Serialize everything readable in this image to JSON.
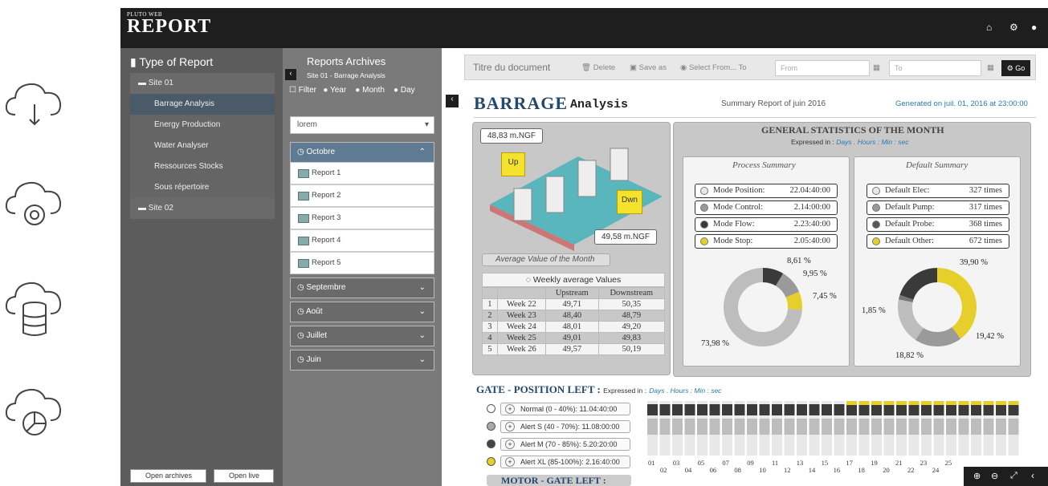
{
  "header": {
    "logo_small": "PLUTO WEB",
    "logo_big": "REPORT"
  },
  "left_icons": [
    "cloud-sync-icon",
    "cloud-gear-icon",
    "cloud-database-icon",
    "cloud-chart-icon"
  ],
  "nav": {
    "title": "Type of Report",
    "items": [
      {
        "label": "Site 01",
        "kind": "site"
      },
      {
        "label": "Barrage Analysis",
        "kind": "sub",
        "active": true
      },
      {
        "label": "Energy Production",
        "kind": "sub"
      },
      {
        "label": "Water Analyser",
        "kind": "sub"
      },
      {
        "label": "Ressources Stocks",
        "kind": "sub"
      },
      {
        "label": "Sous répertoire",
        "kind": "sub"
      },
      {
        "label": "Site 02",
        "kind": "site"
      }
    ],
    "open_archives": "Open archives",
    "open_live": "Open live"
  },
  "archive": {
    "title": "Reports Archives",
    "subtitle": "Site 01 - Barrage Analysis",
    "filter": "Filter",
    "year": "Year",
    "month": "Month",
    "day": "Day",
    "select_value": "lorem",
    "open_month": "Octobre",
    "reports": [
      "Report 1",
      "Report 2",
      "Report 3",
      "Report 4",
      "Report 5"
    ],
    "months": [
      "Septembre",
      "Août",
      "Juillet",
      "Juin"
    ]
  },
  "toolbar": {
    "doc_title": "Titre du document",
    "delete": "Delete",
    "save_as": "Save as",
    "select_from": "Select From... To",
    "from_placeholder": "From",
    "to_placeholder": "To",
    "go": "Go"
  },
  "report": {
    "title_big": "BARRAGE",
    "title_small": "Analysis",
    "summary": "Summary Report of juin 2016",
    "generated": "Generated on juil. 01, 2016 at 23:00:00",
    "upstream_level": "48,83 m.NGF",
    "downstream_level": "49,58 m.NGF",
    "up_label": "Up",
    "down_label": "Dwn",
    "avg_caption": "Average Value of the Month",
    "weekly_title": "Weekly average Values",
    "weekly_headers": [
      "Upstream",
      "Downstream"
    ],
    "weekly": [
      [
        "1",
        "Week 22",
        "49,71",
        "50,35"
      ],
      [
        "2",
        "Week 23",
        "48,40",
        "48,79"
      ],
      [
        "3",
        "Week 24",
        "48,01",
        "49,20"
      ],
      [
        "4",
        "Week 25",
        "49,01",
        "49,83"
      ],
      [
        "5",
        "Week 26",
        "49,57",
        "50,19"
      ]
    ],
    "stats_title": "GENERAL STATISTICS OF THE MONTH",
    "expressed_in": "Expressed in :",
    "units": "Days . Hours : Min : sec",
    "process_title": "Process Summary",
    "default_title": "Default Summary",
    "process": [
      {
        "label": "Mode Position:",
        "value": "22.04:40:00",
        "color": "#e8e8e8"
      },
      {
        "label": "Mode Control:",
        "value": "2.14:00:00",
        "color": "#9a9a9a"
      },
      {
        "label": "Mode Flow:",
        "value": "2.23:40:00",
        "color": "#3a3a3a"
      },
      {
        "label": "Mode Stop:",
        "value": "2.05:40:00",
        "color": "#e6cf2a"
      }
    ],
    "defaults": [
      {
        "label": "Default Elec:",
        "value": "327 times",
        "color": "#e8e8e8"
      },
      {
        "label": "Default Pump:",
        "value": "317 times",
        "color": "#9a9a9a"
      },
      {
        "label": "Default Probe:",
        "value": "368 times",
        "color": "#555"
      },
      {
        "label": "Default Other:",
        "value": "672 times",
        "color": "#e6cf2a"
      }
    ],
    "process_pcts": [
      "8,61 %",
      "9,95 %",
      "7,45 %",
      "73,98 %"
    ],
    "default_pcts": [
      "39,90 %",
      "1,85 %",
      "19,42 %",
      "18,82 %"
    ],
    "gate_title": "GATE",
    "gate_sub": "- POSITION LEFT :",
    "gate_rows": [
      {
        "label": "Normal (0 - 40%): 11.04:40:00",
        "color": "#fff"
      },
      {
        "label": "Alert S (40 - 70%): 11.08:00:00",
        "color": "#aaa"
      },
      {
        "label": "Alert M (70 - 85%): 5.20:20:00",
        "color": "#444"
      },
      {
        "label": "Alert XL (85-100%): 2.16:40:00",
        "color": "#e6cf2a"
      }
    ],
    "motor_title": "MOTOR",
    "motor_sub": "- GATE LEFT :",
    "days_top": [
      "01",
      "03",
      "05",
      "07",
      "09",
      "11",
      "13",
      "15",
      "17",
      "19",
      "21",
      "23",
      "25"
    ],
    "days_bottom": [
      "02",
      "04",
      "06",
      "08",
      "10",
      "12",
      "14",
      "16",
      "18",
      "20",
      "22",
      "24"
    ]
  }
}
